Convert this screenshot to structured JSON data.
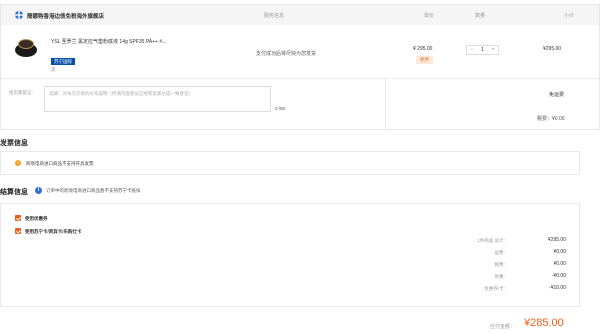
{
  "store": {
    "name": "簡娜购香港边债免税海外旗舰店"
  },
  "columns": {
    "service": "服务信息",
    "unit_price": "单价",
    "quantity": "数量",
    "subtotal": "小计"
  },
  "product": {
    "title": "YSL 圣罗兰 黑定应气垫粉底液 14g SPF35 PA++ #...",
    "badge": "苏宁国际",
    "dot": "流",
    "service": "支付成功后将尽快为您发货",
    "price": "¥ 295.00",
    "tax_tag": "税费",
    "qty_minus": "−",
    "qty_value": "1",
    "qty_plus": "+",
    "subtotal": "¥295.00"
  },
  "message": {
    "label": "给卖家留言：",
    "placeholder": "选填：对本次交易的补充说明（所填内容建议已经和卖家达成一致意见）",
    "count": "0 /85"
  },
  "shipping": {
    "label": "免运费"
  },
  "tax": {
    "label": "税费：¥0.00"
  },
  "invoice": {
    "title": "发票信息",
    "notice": "跨境电商进口商品不支持开具发票"
  },
  "settlement": {
    "title": "结算信息",
    "note": "订单中的跨境电商进口商品暂不支持苏宁卡抵扣",
    "options": [
      "使用优惠券",
      "使用苏宁卡/资宾卡/乐购仕卡"
    ],
    "summary": [
      {
        "label": "1件商品 总计：",
        "value": "¥295.00"
      },
      {
        "label": "运费：",
        "value": "¥0.00"
      },
      {
        "label": "税费：",
        "value": "¥0.00"
      },
      {
        "label": "优惠：",
        "value": "-¥0.00"
      },
      {
        "label": "优惠券/卡：",
        "value": "-¥10.00"
      }
    ]
  },
  "payable": {
    "label": "应付金额：",
    "value": "¥285.00"
  },
  "colors": {
    "accent": "#f25c19",
    "brand_blue": "#0a4fa8",
    "warning": "#f0a020"
  }
}
